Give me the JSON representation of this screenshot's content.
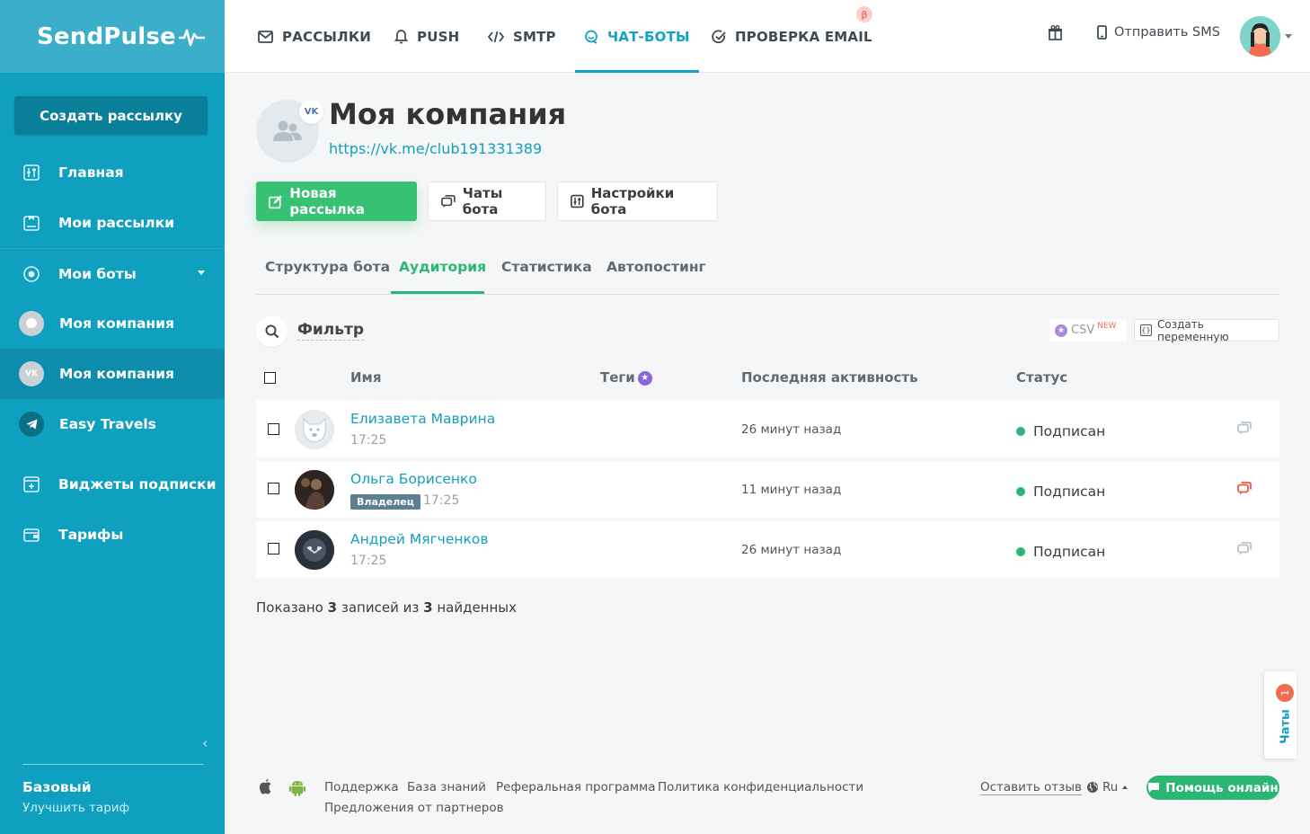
{
  "app": {
    "logo": "SendPulse"
  },
  "sidebar": {
    "create_button": "Создать рассылку",
    "items": [
      {
        "label": "Главная",
        "icon": "dashboard-icon"
      },
      {
        "label": "Мои рассылки",
        "icon": "campaigns-icon"
      },
      {
        "label": "Мои боты",
        "icon": "bots-icon",
        "expanded": true
      },
      {
        "label": "Моя компания",
        "icon": "messenger-icon"
      },
      {
        "label": "Моя компания",
        "icon": "vk-icon",
        "active": true
      },
      {
        "label": "Easy Travels",
        "icon": "telegram-icon"
      },
      {
        "label": "Виджеты подписки",
        "icon": "widget-icon"
      },
      {
        "label": "Тарифы",
        "icon": "wallet-icon"
      }
    ],
    "plan_name": "Базовый",
    "plan_upgrade": "Улучшить тариф"
  },
  "topnav": {
    "items": [
      {
        "label": "РАССЫЛКИ",
        "icon": "mail-icon"
      },
      {
        "label": "PUSH",
        "icon": "bell-icon"
      },
      {
        "label": "SMTP",
        "icon": "code-icon"
      },
      {
        "label": "ЧАТ-БОТЫ",
        "icon": "chat-bot-icon",
        "active": true
      },
      {
        "label": "ПРОВЕРКА EMAIL",
        "icon": "check-icon",
        "badge": "β"
      }
    ],
    "sms_label": "Отправить SMS"
  },
  "page": {
    "title": "Моя компания",
    "link": "https://vk.me/club191331389",
    "vk_badge": "VK",
    "buttons": {
      "new_campaign": "Новая рассылка",
      "bot_chats": "Чаты бота",
      "bot_settings": "Настройки бота"
    },
    "tabs": [
      {
        "label": "Структура бота"
      },
      {
        "label": "Аудитория",
        "active": true
      },
      {
        "label": "Статистика"
      },
      {
        "label": "Автопостинг"
      }
    ],
    "filter_label": "Фильтр",
    "csv_label": "CSV",
    "csv_new": "NEW",
    "create_variable": "Создать переменную"
  },
  "table": {
    "headers": {
      "name": "Имя",
      "tags": "Теги",
      "last_activity": "Последняя активность",
      "status": "Статус"
    },
    "rows": [
      {
        "name": "Елизавета Маврина",
        "time": "17:25",
        "activity": "26 минут назад",
        "status": "Подписан",
        "owner": false,
        "chat_highlight": false
      },
      {
        "name": "Ольга Борисенко",
        "time": "17:25",
        "activity": "11 минут назад",
        "status": "Подписан",
        "owner": true,
        "owner_label": "Владелец",
        "chat_highlight": true
      },
      {
        "name": "Андрей Мягченков",
        "time": "17:25",
        "activity": "26 минут назад",
        "status": "Подписан",
        "owner": false,
        "chat_highlight": false
      }
    ],
    "summary": {
      "prefix": "Показано",
      "shown": "3",
      "middle": "записей из",
      "found": "3",
      "suffix": "найденных"
    }
  },
  "chats_widget": {
    "label": "Чаты",
    "count": "1"
  },
  "footer": {
    "links": [
      "Поддержка",
      "База знаний",
      "Реферальная программа",
      "Политика конфиденциальности",
      "Предложения от партнеров"
    ],
    "feedback": "Оставить отзыв",
    "language": "Ru",
    "help_button": "Помощь онлайн"
  },
  "colors": {
    "sidebar": "#0f9fbf",
    "accent": "#11a3c4",
    "green": "#37c273",
    "link": "#12a0bd"
  }
}
